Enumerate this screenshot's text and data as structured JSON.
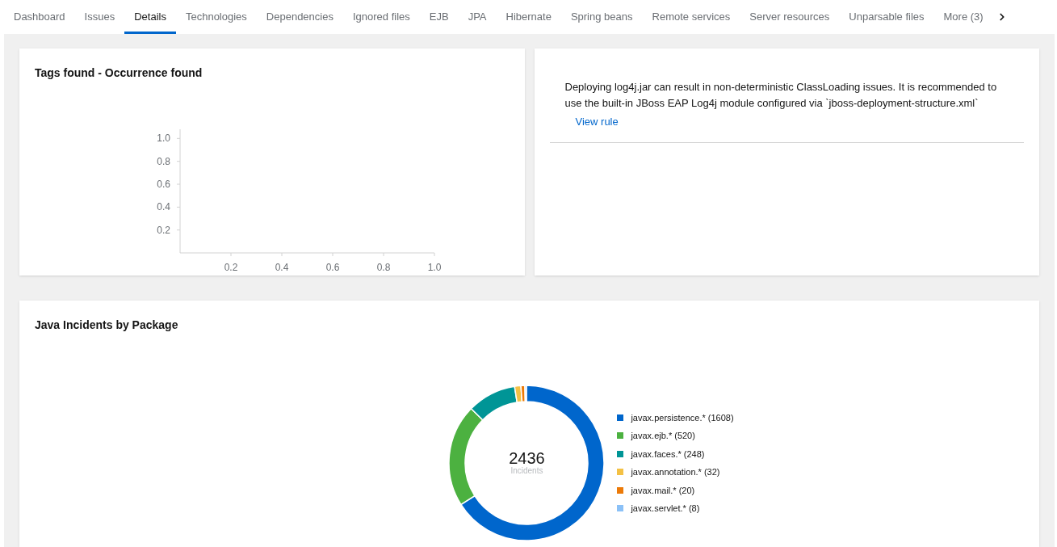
{
  "tabs": [
    {
      "label": "Dashboard",
      "selected": false
    },
    {
      "label": "Issues",
      "selected": false
    },
    {
      "label": "Details",
      "selected": true
    },
    {
      "label": "Technologies",
      "selected": false
    },
    {
      "label": "Dependencies",
      "selected": false
    },
    {
      "label": "Ignored files",
      "selected": false
    },
    {
      "label": "EJB",
      "selected": false
    },
    {
      "label": "JPA",
      "selected": false
    },
    {
      "label": "Hibernate",
      "selected": false
    },
    {
      "label": "Spring beans",
      "selected": false
    },
    {
      "label": "Remote services",
      "selected": false
    },
    {
      "label": "Server resources",
      "selected": false
    },
    {
      "label": "Unparsable files",
      "selected": false
    },
    {
      "label": "More (3)",
      "selected": false
    }
  ],
  "tags_card": {
    "chart_data": {
      "type": "bar",
      "title": "Tags found - Occurrence found",
      "xlim": [
        0,
        1
      ],
      "ylim": [
        0,
        1.08
      ],
      "xticks": [
        {
          "value": 0.2,
          "label": "0.2"
        },
        {
          "value": 0.4,
          "label": "0.4"
        },
        {
          "value": 0.6,
          "label": "0.6"
        },
        {
          "value": 0.8,
          "label": "0.8"
        },
        {
          "value": 1,
          "label": "1.0"
        }
      ],
      "yticks": [
        {
          "value": 0.2,
          "label": "0.2"
        },
        {
          "value": 0.4,
          "label": "0.4"
        },
        {
          "value": 0.6,
          "label": "0.6"
        },
        {
          "value": 0.8,
          "label": "0.8"
        },
        {
          "value": 1,
          "label": "1.0"
        }
      ]
    }
  },
  "rule_card": {
    "message": "Deploying log4j.jar can result in non-deterministic ClassLoading issues. It is recommended to use the built-in JBoss EAP Log4j module configured via `jboss-deployment-structure.xml`",
    "link": "View rule"
  },
  "package_card": {
    "title": "Java Incidents by Package",
    "total": "2436",
    "chart_data": {
      "type": "donut",
      "categories": [
        "javax.persistence.* (1608)",
        "javax.ejb.* (520)",
        "javax.faces.* (248)",
        "javax.annotation.* (32)",
        "javax.mail.* (20)",
        "javax.servlet.* (8)"
      ],
      "series": [
        {
          "name": "Incidents",
          "values": [
            1608,
            520,
            248,
            32,
            20,
            8
          ]
        }
      ],
      "colors": [
        "#0066cc",
        "#4cb140",
        "#009596",
        "#f4c145",
        "#ec7a08",
        "#8bc1f7"
      ]
    }
  }
}
